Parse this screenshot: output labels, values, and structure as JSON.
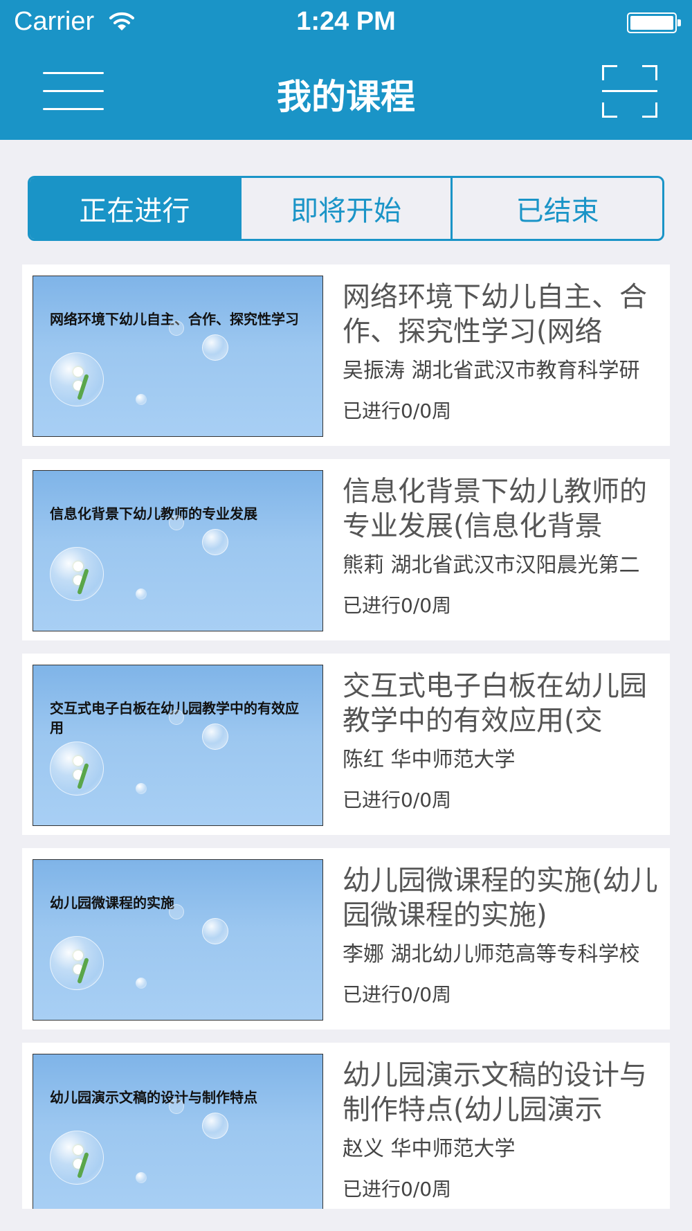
{
  "status_bar": {
    "carrier": "Carrier",
    "time": "1:24 PM",
    "wifi_icon": "wifi-icon",
    "battery_icon": "battery-icon"
  },
  "header": {
    "title": "我的课程",
    "menu_icon": "hamburger-menu-icon",
    "scan_icon": "qr-scan-icon"
  },
  "tabs": [
    {
      "label": "正在进行",
      "active": true
    },
    {
      "label": "即将开始",
      "active": false
    },
    {
      "label": "已结束",
      "active": false
    }
  ],
  "colors": {
    "primary": "#1a94c7",
    "background": "#efeff4"
  },
  "courses": [
    {
      "thumb_text": "网络环境下幼儿自主、合作、探究性学习",
      "title": "网络环境下幼儿自主、合作、探究性学习(网络",
      "teacher": "吴振涛 湖北省武汉市教育科学研",
      "progress": "已进行0/0周"
    },
    {
      "thumb_text": "信息化背景下幼儿教师的专业发展",
      "title": "信息化背景下幼儿教师的专业发展(信息化背景",
      "teacher": "熊莉 湖北省武汉市汉阳晨光第二",
      "progress": "已进行0/0周"
    },
    {
      "thumb_text": "交互式电子白板在幼儿园教学中的有效应用",
      "title": "交互式电子白板在幼儿园教学中的有效应用(交",
      "teacher": "陈红 华中师范大学",
      "progress": "已进行0/0周"
    },
    {
      "thumb_text": "幼儿园微课程的实施",
      "title": "幼儿园微课程的实施(幼儿园微课程的实施)",
      "teacher": "李娜 湖北幼儿师范高等专科学校",
      "progress": "已进行0/0周"
    },
    {
      "thumb_text": "幼儿园演示文稿的设计与制作特点",
      "title": "幼儿园演示文稿的设计与制作特点(幼儿园演示",
      "teacher": "赵义 华中师范大学",
      "progress": "已进行0/0周"
    }
  ]
}
